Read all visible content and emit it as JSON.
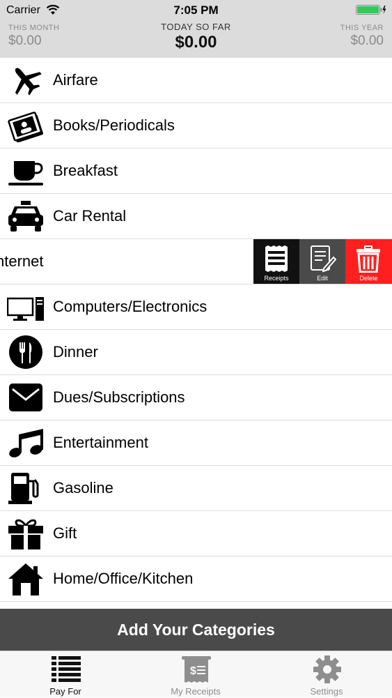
{
  "status_bar": {
    "carrier": "Carrier",
    "time": "7:05 PM",
    "battery_color": "#34c759"
  },
  "totals": {
    "month": {
      "label": "THIS MONTH",
      "amount": "$0.00"
    },
    "today": {
      "label": "TODAY SO FAR",
      "amount": "$0.00"
    },
    "year": {
      "label": "THIS YEAR",
      "amount": "$0.00"
    }
  },
  "categories": [
    {
      "label": "Airfare",
      "icon": "airplane-icon"
    },
    {
      "label": "Books/Periodicals",
      "icon": "books-icon"
    },
    {
      "label": "Breakfast",
      "icon": "coffee-cup-icon"
    },
    {
      "label": "Car Rental",
      "icon": "taxi-icon"
    },
    {
      "label": "nternet",
      "icon": ""
    },
    {
      "label": "Computers/Electronics",
      "icon": "computer-icon"
    },
    {
      "label": "Dinner",
      "icon": "fork-knife-icon"
    },
    {
      "label": "Dues/Subscriptions",
      "icon": "envelope-icon"
    },
    {
      "label": "Entertainment",
      "icon": "music-note-icon"
    },
    {
      "label": "Gasoline",
      "icon": "gas-pump-icon"
    },
    {
      "label": "Gift",
      "icon": "gift-icon"
    },
    {
      "label": "Home/Office/Kitchen",
      "icon": "house-icon"
    }
  ],
  "swipe_actions": {
    "receipts": "Receipts",
    "edit": "Edit",
    "delete": "Delete",
    "delete_color": "#ff1f1f"
  },
  "add_bar": {
    "label": "Add Your Categories"
  },
  "tabs": {
    "pay_for": "Pay For",
    "my_receipts": "My Receipts",
    "settings": "Settings"
  }
}
